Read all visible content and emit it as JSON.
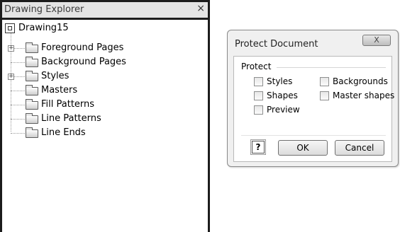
{
  "explorer": {
    "title": "Drawing Explorer",
    "close_glyph": "×",
    "root": {
      "label": "Drawing15",
      "icon": "document-icon"
    },
    "items": [
      {
        "label": "Foreground Pages",
        "expandable": true
      },
      {
        "label": "Background Pages",
        "expandable": false
      },
      {
        "label": "Styles",
        "expandable": true
      },
      {
        "label": "Masters",
        "expandable": false
      },
      {
        "label": "Fill Patterns",
        "expandable": false
      },
      {
        "label": "Line Patterns",
        "expandable": false
      },
      {
        "label": "Line Ends",
        "expandable": false
      }
    ]
  },
  "dialog": {
    "title": "Protect Document",
    "close_glyph": "X",
    "group_label": "Protect",
    "options": [
      {
        "label": "Styles",
        "checked": false
      },
      {
        "label": "Backgrounds",
        "checked": false
      },
      {
        "label": "Shapes",
        "checked": false
      },
      {
        "label": "Master shapes",
        "checked": false
      },
      {
        "label": "Preview",
        "checked": false
      }
    ],
    "help_glyph": "?",
    "ok_label": "OK",
    "cancel_label": "Cancel"
  }
}
